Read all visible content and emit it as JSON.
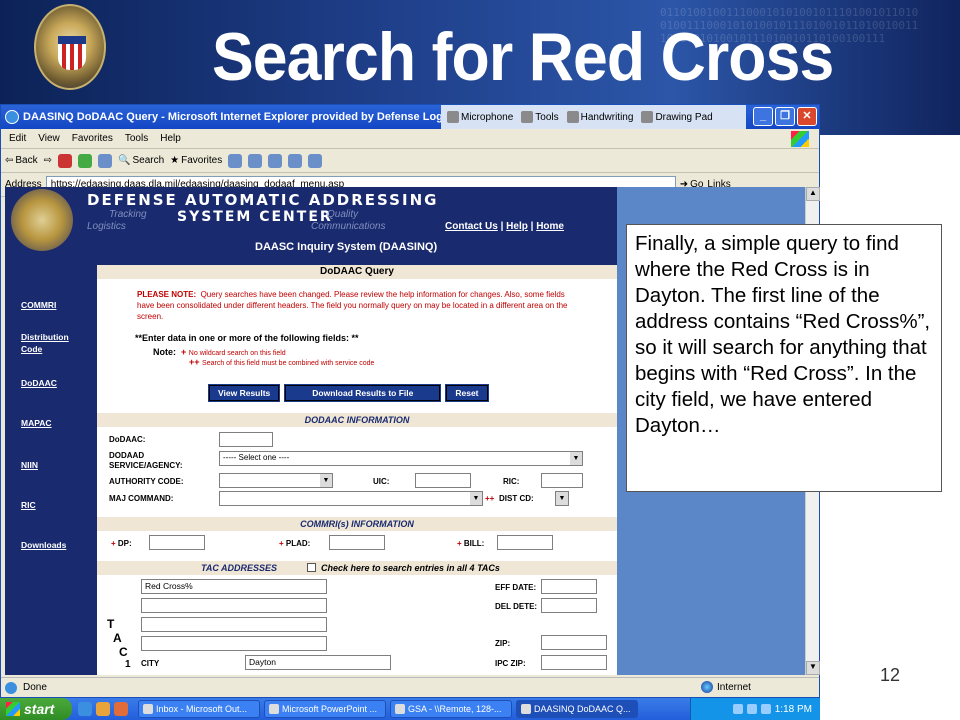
{
  "slide": {
    "title": "Search for Red Cross",
    "page_number": "12",
    "callout_text": "Finally, a simple query to find where the Red Cross is in Dayton.  The first line of the address contains “Red Cross%”, so it will search for anything that begins with “Red Cross”.  In the city field, we have entered Dayton…"
  },
  "window": {
    "title": "DAASINQ DoDAAC Query - Microsoft Internet Explorer provided by Defense Logistics A",
    "langbar": [
      "Microphone",
      "Tools",
      "Handwriting",
      "Drawing Pad"
    ],
    "menu": [
      "Edit",
      "View",
      "Favorites",
      "Tools",
      "Help"
    ],
    "toolbar": [
      "Back",
      "Search",
      "Favorites"
    ],
    "address_label": "Address",
    "address_value": "https://edaasinq.daas.dla.mil/edaasinq/daasinq_dodaaf_menu.asp",
    "go_label": "Go",
    "links_label": "Links",
    "status_text": "Done",
    "zone_text": "Internet"
  },
  "page": {
    "header_line1": "DEFENSE AUTOMATIC ADDRESSING",
    "header_line2": "SYSTEM CENTER",
    "header_faint": [
      "Tracking",
      "Logistics",
      "Quality",
      "Communications"
    ],
    "links": [
      "Contact Us",
      "Help",
      "Home"
    ],
    "system_title": "DAASC Inquiry System (DAASINQ)",
    "nav": [
      "COMMRI",
      "Distribution Code",
      "DoDAAC",
      "MAPAC",
      "NIIN",
      "RIC",
      "Downloads"
    ],
    "query_title": "DoDAAC Query",
    "please_note_label": "PLEASE NOTE:",
    "please_note_text": "Query searches have been changed. Please review the help information for changes. Also, some fields have been consolidated under different headers. The field you normally query on may be located in a different area on the screen.",
    "enter_text": "**Enter data in one or more of the following fields: **",
    "note_label": "Note:",
    "note_plus": "+",
    "note_plus_text": "No wildcard search on this field",
    "note_pp": "++",
    "note_pp_text": "Search of this field must be combined with service code",
    "buttons": [
      "View Results",
      "Download Results to File",
      "Reset"
    ],
    "dodaac_section": "DODAAC INFORMATION",
    "fields": {
      "dodaac": "DoDAAC:",
      "dodaad": "DODAAD",
      "service": "SERVICE/AGENCY:",
      "service_value": "----- Select one ----",
      "authority": "AUTHORITY CODE:",
      "uic": "UIC:",
      "ric": "RIC:",
      "maj": "MAJ COMMAND:",
      "dist": "DIST CD:",
      "dist_marker": "++"
    },
    "commri_section": "COMMRI(s) INFORMATION",
    "commri": {
      "dp": "DP:",
      "plad": "PLAD:",
      "bill": "BILL:",
      "marker": "+"
    },
    "tac_section": "TAC ADDRESSES",
    "tac_check": "Check here to search entries in all 4 TACs",
    "tac_letters": [
      "T",
      "A",
      "C",
      "1"
    ],
    "tac": {
      "line1_value": "Red Cross%",
      "eff_date": "EFF DATE:",
      "del_date": "DEL DETE:",
      "zip": "ZIP:",
      "city": "CITY",
      "city_value": "Dayton",
      "ipc_zip": "IPC ZIP:"
    }
  },
  "taskbar": {
    "start": "start",
    "tasks": [
      "Inbox - Microsoft Out...",
      "Microsoft PowerPoint ...",
      "GSA - \\\\Remote, 128-...",
      "DAASINQ DoDAAC Q..."
    ],
    "clock": "1:18 PM"
  }
}
